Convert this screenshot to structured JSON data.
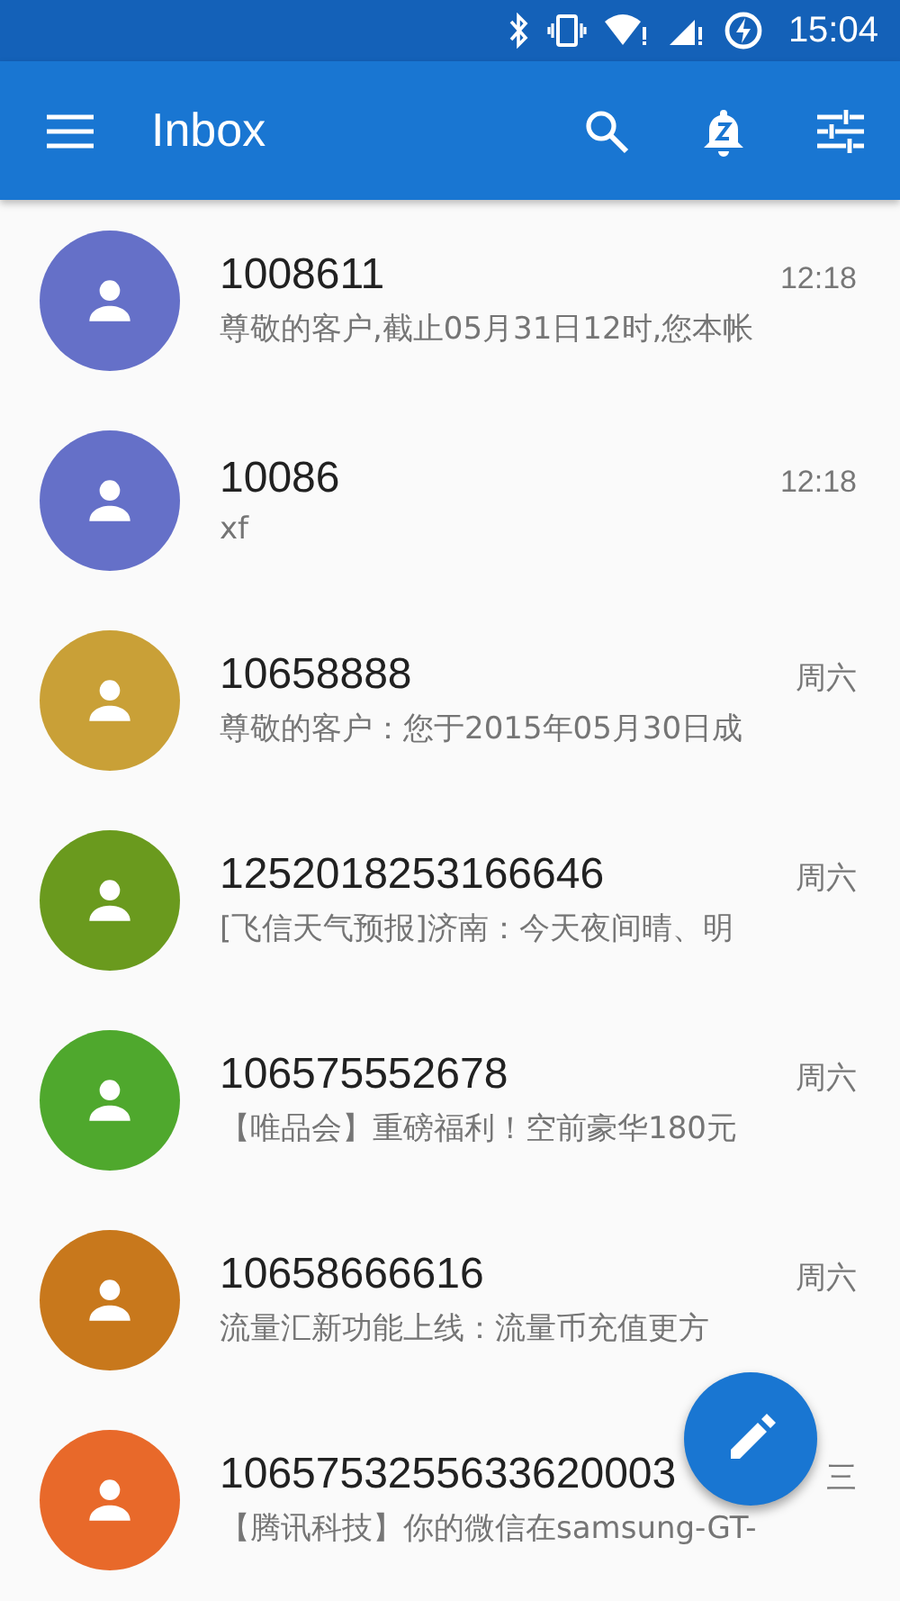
{
  "status_bar": {
    "time": "15:04"
  },
  "app_bar": {
    "title": "Inbox"
  },
  "conversations": [
    {
      "sender": "1008611",
      "time": "12:18",
      "preview": "尊敬的客户,截止05月31日12时,您本帐",
      "color": "#6570c8"
    },
    {
      "sender": "10086",
      "time": "12:18",
      "preview": "xf",
      "color": "#6570c8"
    },
    {
      "sender": "10658888",
      "time": "周六",
      "preview": "尊敬的客户：您于2015年05月30日成",
      "color": "#c9a037"
    },
    {
      "sender": "1252018253166646",
      "time": "周六",
      "preview": "[飞信天气预报]济南：今天夜间晴、明",
      "color": "#6a9a1e"
    },
    {
      "sender": "106575552678",
      "time": "周六",
      "preview": "【唯品会】重磅福利！空前豪华180元",
      "color": "#4fa82d"
    },
    {
      "sender": "10658666616",
      "time": "周六",
      "preview": "流量汇新功能上线：流量币充值更方",
      "color": "#c8781c"
    },
    {
      "sender": "1065753255633620003",
      "time": "三",
      "preview": "【腾讯科技】你的微信在samsung-GT-",
      "color": "#e8692a"
    }
  ]
}
